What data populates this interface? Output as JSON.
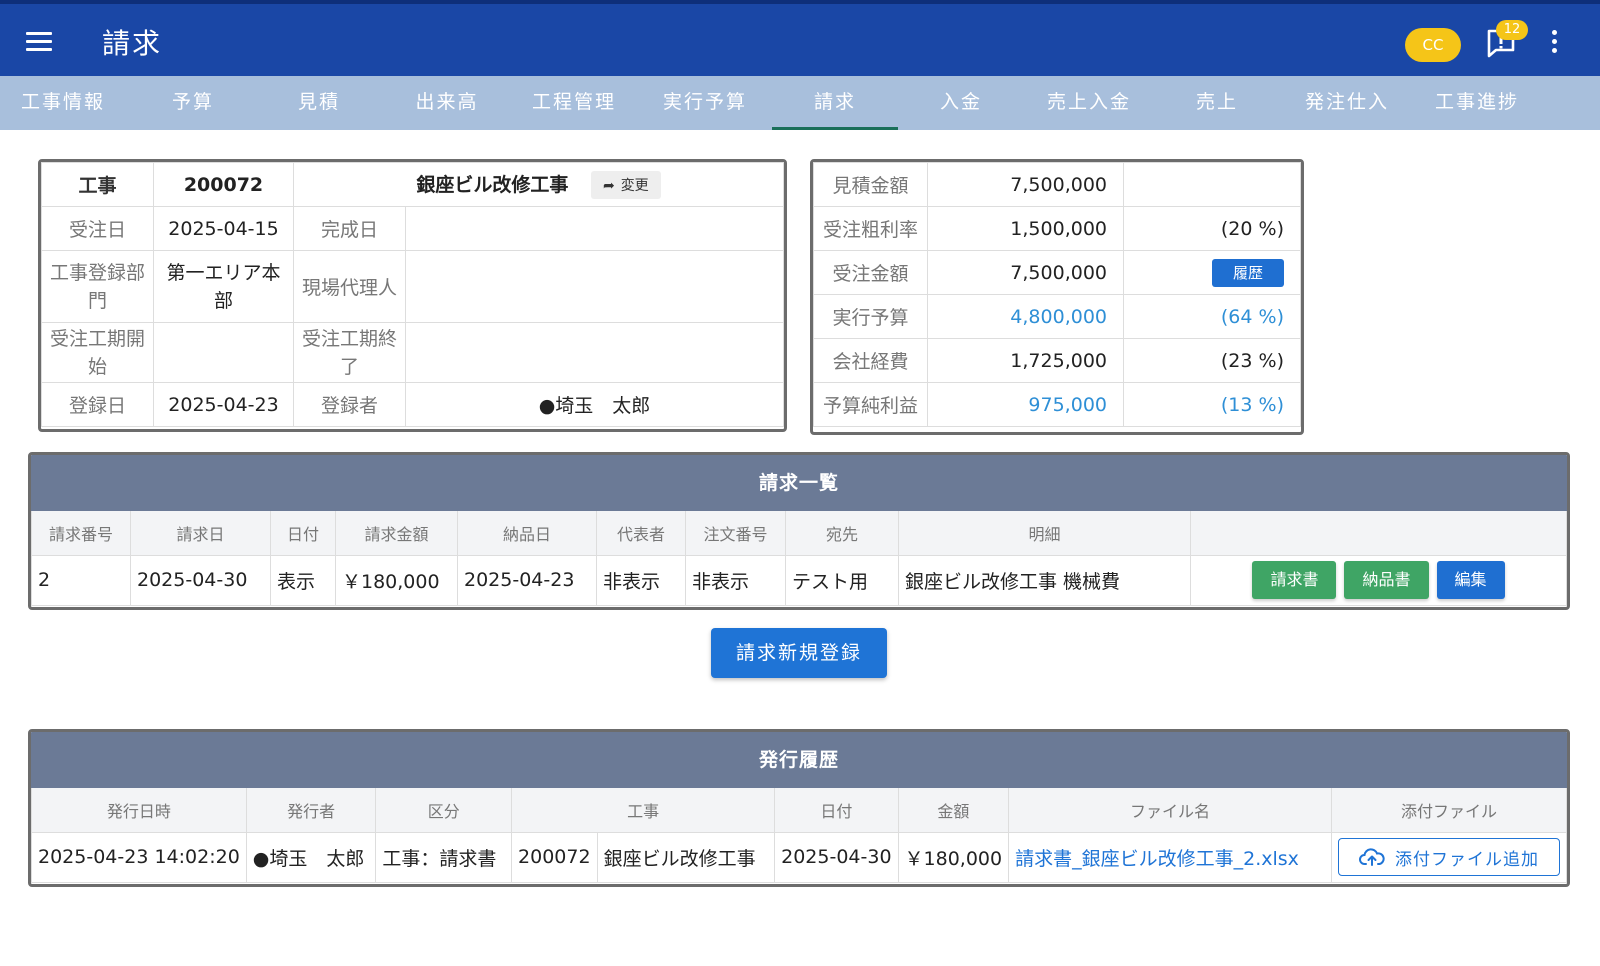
{
  "appbar": {
    "title": "請求",
    "user_initials": "CC",
    "notification_count": "12"
  },
  "tabs": [
    {
      "label": "工事情報"
    },
    {
      "label": "予算"
    },
    {
      "label": "見積"
    },
    {
      "label": "出来高"
    },
    {
      "label": "工程管理"
    },
    {
      "label": "実行予算"
    },
    {
      "label": "請求",
      "active": true
    },
    {
      "label": "入金"
    },
    {
      "label": "売上入金"
    },
    {
      "label": "売上"
    },
    {
      "label": "発注仕入"
    },
    {
      "label": "工事進捗"
    }
  ],
  "project": {
    "label_project": "工事",
    "project_code": "200072",
    "project_name": "銀座ビル改修工事",
    "change_label": "変更",
    "label_order_date": "受注日",
    "order_date": "2025-04-15",
    "label_complete_date": "完成日",
    "complete_date": "",
    "label_dept": "工事登録部門",
    "dept": "第一エリア本部",
    "label_site_agent": "現場代理人",
    "site_agent": "",
    "label_period_start": "受注工期開始",
    "period_start": "",
    "label_period_end": "受注工期終了",
    "period_end": "",
    "label_reg_date": "登録日",
    "reg_date": "2025-04-23",
    "label_registrant": "登録者",
    "registrant": "●埼玉　太郎"
  },
  "summary": {
    "rows": [
      {
        "label": "見積金額",
        "value": "7,500,000",
        "extra": ""
      },
      {
        "label": "受注粗利率",
        "value": "1,500,000",
        "extra": "(20 %)"
      },
      {
        "label": "受注金額",
        "value": "7,500,000",
        "extra": ""
      },
      {
        "label": "実行予算",
        "value": "4,800,000",
        "extra": "(64 %)"
      },
      {
        "label": "会社経費",
        "value": "1,725,000",
        "extra": "(23 %)"
      },
      {
        "label": "予算純利益",
        "value": "975,000",
        "extra": "(13 %)"
      }
    ],
    "history_label": "履歴"
  },
  "invoice_list": {
    "title": "請求一覧",
    "headers": [
      "請求番号",
      "請求日",
      "日付",
      "請求金額",
      "納品日",
      "代表者",
      "注文番号",
      "宛先",
      "明細",
      ""
    ],
    "rows": [
      {
        "no": "2",
        "invoice_date": "2025-04-30",
        "date": "表示",
        "amount": "￥180,000",
        "delivery_date": "2025-04-23",
        "representative": "非表示",
        "order_no": "非表示",
        "recipient": "テスト用",
        "detail": "銀座ビル改修工事 機械費",
        "btn_invoice": "請求書",
        "btn_delivery": "納品書",
        "btn_edit": "編集"
      }
    ]
  },
  "new_invoice_label": "請求新規登録",
  "issue_history": {
    "title": "発行履歴",
    "headers": [
      "発行日時",
      "発行者",
      "区分",
      "工事",
      "日付",
      "金額",
      "ファイル名",
      "添付ファイル"
    ],
    "rows": [
      {
        "datetime": "2025-04-23 14:02:20",
        "issuer": "●埼玉　太郎",
        "category": "工事：請求書",
        "project_code": "200072",
        "project_name": "銀座ビル改修工事",
        "date": "2025-04-30",
        "amount": "￥180,000",
        "file_name": "請求書_銀座ビル改修工事_2.xlsx",
        "attach_label": "添付ファイル追加"
      }
    ]
  },
  "colors": {
    "appbar": "#1a47a6",
    "tabbar": "#a8bfdc",
    "section_head": "#6b7a96",
    "accent_blue": "#1f74d6",
    "green": "#3fa565",
    "badge_yellow": "#f5c518",
    "link_blue": "#2e8fd6"
  }
}
